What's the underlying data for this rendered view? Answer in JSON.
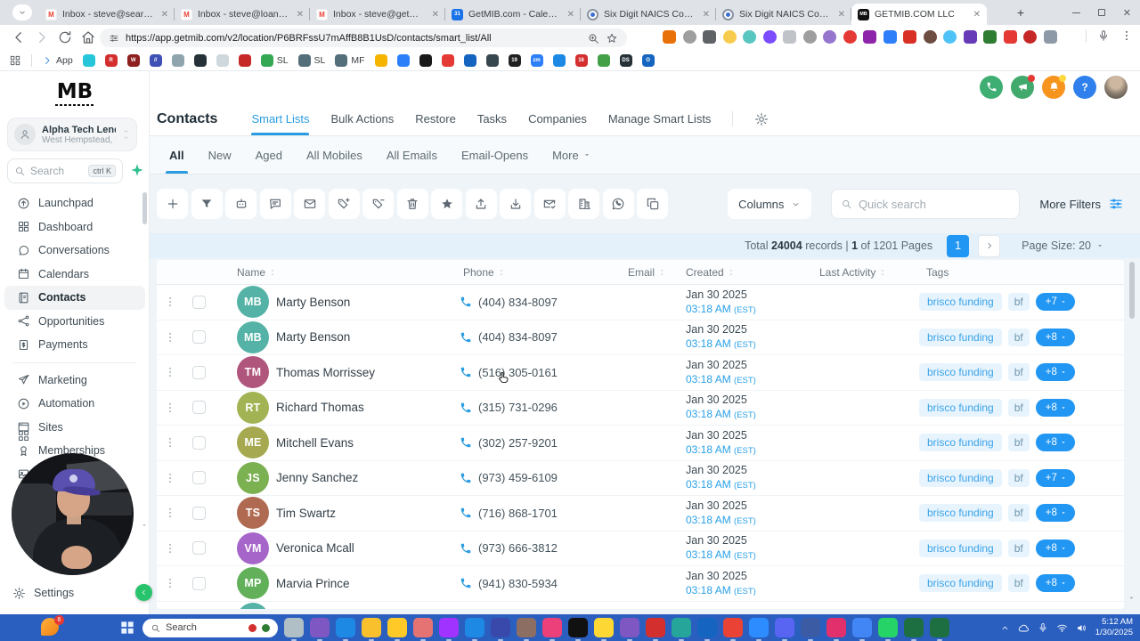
{
  "browser": {
    "tabs": [
      {
        "title": "Inbox - steve@searchlightlend",
        "favicon": "gmail",
        "active": false
      },
      {
        "title": "Inbox - steve@loandaddy.ai - C",
        "favicon": "gmail",
        "active": false
      },
      {
        "title": "Inbox - steve@getmib.com - G",
        "favicon": "gmail",
        "active": false
      },
      {
        "title": "GetMIB.com - Calendar - Week",
        "favicon": "calendar",
        "active": false
      },
      {
        "title": "Six Digit NAICS Codes & Titles",
        "favicon": "naics",
        "active": false
      },
      {
        "title": "Six Digit NAICS Codes & Titles",
        "favicon": "naics",
        "active": false
      },
      {
        "title": "GETMIB.COM LLC",
        "favicon": "mb",
        "active": true
      }
    ],
    "url": "https://app.getmib.com/v2/location/P6BRFssU7mAffB8B1UsD/contacts/smart_list/All",
    "extensions": [
      "#e8710a",
      "#9e9e9e",
      "#5f6368",
      "#f7cb4d",
      "#58c7c0",
      "#7c4dff",
      "#c0c4c9",
      "#9e9e9e",
      "#9575cd",
      "#e53935",
      "#8e24aa",
      "#2d7ff9",
      "#d93025",
      "#6d4c41",
      "#4fc3f7",
      "#673ab7",
      "#2e7d32",
      "#e53935",
      "#c62828",
      "#8d99a6"
    ]
  },
  "bookmarks": {
    "app_label": "App",
    "items": [
      {
        "c": "#26c6da"
      },
      {
        "c": "#d32f2f",
        "t": "R"
      },
      {
        "c": "#8d1f1f",
        "t": "W"
      },
      {
        "c": "#3f51b5",
        "t": "//"
      },
      {
        "c": "#90a4ae"
      },
      {
        "c": "#263238"
      },
      {
        "c": "#cfd8dc"
      },
      {
        "c": "#c62828"
      },
      {
        "c": "#34a853",
        "label": "SL"
      },
      {
        "c": "#546e7a",
        "label": "SL"
      },
      {
        "c": "#546e7a",
        "label": "MF"
      },
      {
        "c": "#f4b400"
      },
      {
        "c": "#2d7ff9"
      },
      {
        "c": "#1a1a1a"
      },
      {
        "c": "#e53935"
      },
      {
        "c": "#1565c0"
      },
      {
        "c": "#37474f"
      },
      {
        "c": "#212121",
        "t": "19"
      },
      {
        "c": "#2d7ff9",
        "t": "zm"
      },
      {
        "c": "#1e88e5"
      },
      {
        "c": "#d32f2f",
        "t": "16"
      },
      {
        "c": "#43a047"
      },
      {
        "c": "#263238",
        "t": "DS"
      },
      {
        "c": "#1565c0",
        "t": "O"
      }
    ]
  },
  "sidebar": {
    "logo": "MB",
    "account": {
      "name": "Alpha Tech Lending",
      "location": "West Hempstead, NY"
    },
    "search": {
      "placeholder": "Search",
      "shortcut": "ctrl K"
    },
    "items": [
      {
        "icon": "launchpad",
        "label": "Launchpad"
      },
      {
        "icon": "dashboard",
        "label": "Dashboard"
      },
      {
        "icon": "conversations",
        "label": "Conversations"
      },
      {
        "icon": "calendars",
        "label": "Calendars"
      },
      {
        "icon": "contactsbook",
        "label": "Contacts",
        "active": true
      },
      {
        "icon": "opportunities",
        "label": "Opportunities"
      },
      {
        "icon": "payments",
        "label": "Payments"
      },
      {
        "divider": true
      },
      {
        "icon": "marketing",
        "label": "Marketing"
      },
      {
        "icon": "automation",
        "label": "Automation"
      },
      {
        "icon": "sites",
        "label": "Sites"
      },
      {
        "icon": "memberships",
        "label": "Memberships"
      },
      {
        "icon": "media",
        "label": ""
      }
    ],
    "settings_label": "Settings"
  },
  "header_icons": [
    "phone",
    "megaphone",
    "notifications",
    "help",
    "profile"
  ],
  "page": {
    "title": "Contacts",
    "tabs": [
      {
        "label": "Smart Lists",
        "active": true
      },
      {
        "label": "Bulk Actions",
        "active": false
      },
      {
        "label": "Restore",
        "active": false
      },
      {
        "label": "Tasks",
        "active": false
      },
      {
        "label": "Companies",
        "active": false
      },
      {
        "label": "Manage Smart Lists",
        "active": false
      }
    ],
    "filter_tabs": [
      {
        "label": "All",
        "active": true
      },
      {
        "label": "New",
        "active": false
      },
      {
        "label": "Aged",
        "active": false
      },
      {
        "label": "All Mobiles",
        "active": false
      },
      {
        "label": "All Emails",
        "active": false
      },
      {
        "label": "Email-Opens",
        "active": false
      },
      {
        "label": "More",
        "active": false,
        "caret": true
      }
    ]
  },
  "toolbar": {
    "buttons": [
      "plus",
      "funnel",
      "bot",
      "sms",
      "mail",
      "tagplus",
      "tagminus",
      "trash",
      "starfill",
      "upload",
      "download",
      "mailcheck",
      "building",
      "whatsapp",
      "copy"
    ],
    "columns_label": "Columns",
    "search_placeholder": "Quick search",
    "more_filters_label": "More Filters"
  },
  "pagination": {
    "total_label": "Total",
    "total": "24004",
    "mid": "records |",
    "page": "1",
    "pages": "of 1201 Pages",
    "page_btn": "1",
    "size_label": "Page Size: 20"
  },
  "table": {
    "columns": [
      {
        "label": "Name",
        "sort": true
      },
      {
        "label": "Phone",
        "sort": true
      },
      {
        "label": "Email",
        "sort": true
      },
      {
        "label": "Created",
        "sort": true
      },
      {
        "label": "Last Activity",
        "sort": true
      },
      {
        "label": "Tags",
        "sort": false
      }
    ],
    "rows": [
      {
        "initials": "MB",
        "color": "#54b3a6",
        "name": "Marty Benson",
        "phone": "(404) 834-8097",
        "date": "Jan 30 2025",
        "time": "03:18 AM",
        "tz": "(EST)",
        "tag1": "brisco funding",
        "tag2": "bf",
        "more": "+7"
      },
      {
        "initials": "MB",
        "color": "#54b3a6",
        "name": "Marty Benson",
        "phone": "(404) 834-8097",
        "date": "Jan 30 2025",
        "time": "03:18 AM",
        "tz": "(EST)",
        "tag1": "brisco funding",
        "tag2": "bf",
        "more": "+8"
      },
      {
        "initials": "TM",
        "color": "#b0557c",
        "name": "Thomas Morrissey",
        "phone": "(516) 305-0161",
        "date": "Jan 30 2025",
        "time": "03:18 AM",
        "tz": "(EST)",
        "tag1": "brisco funding",
        "tag2": "bf",
        "more": "+8"
      },
      {
        "initials": "RT",
        "color": "#a2b353",
        "name": "Richard Thomas",
        "phone": "(315) 731-0296",
        "date": "Jan 30 2025",
        "time": "03:18 AM",
        "tz": "(EST)",
        "tag1": "brisco funding",
        "tag2": "bf",
        "more": "+8"
      },
      {
        "initials": "ME",
        "color": "#a6a94f",
        "name": "Mitchell Evans",
        "phone": "(302) 257-9201",
        "date": "Jan 30 2025",
        "time": "03:18 AM",
        "tz": "(EST)",
        "tag1": "brisco funding",
        "tag2": "bf",
        "more": "+8"
      },
      {
        "initials": "JS",
        "color": "#7cb152",
        "name": "Jenny Sanchez",
        "phone": "(973) 459-6109",
        "date": "Jan 30 2025",
        "time": "03:18 AM",
        "tz": "(EST)",
        "tag1": "brisco funding",
        "tag2": "bf",
        "more": "+7"
      },
      {
        "initials": "TS",
        "color": "#b06a52",
        "name": "Tim Swartz",
        "phone": "(716) 868-1701",
        "date": "Jan 30 2025",
        "time": "03:18 AM",
        "tz": "(EST)",
        "tag1": "brisco funding",
        "tag2": "bf",
        "more": "+8"
      },
      {
        "initials": "VM",
        "color": "#a565c9",
        "name": "Veronica Mcall",
        "phone": "(973) 666-3812",
        "date": "Jan 30 2025",
        "time": "03:18 AM",
        "tz": "(EST)",
        "tag1": "brisco funding",
        "tag2": "bf",
        "more": "+8"
      },
      {
        "initials": "MP",
        "color": "#62b15a",
        "name": "Marvia Prince",
        "phone": "(941) 830-5934",
        "date": "Jan 30 2025",
        "time": "03:18 AM",
        "tz": "(EST)",
        "tag1": "brisco funding",
        "tag2": "bf",
        "more": "+8"
      }
    ],
    "partial_row": {
      "initials": "",
      "color": "#54b3a6",
      "name": "",
      "phone": "",
      "date": "",
      "time": "",
      "tz": "",
      "tag1": "",
      "tag2": "",
      "more": ""
    }
  },
  "taskbar": {
    "badge": "6",
    "search_placeholder": "Search",
    "apps": [
      {
        "c": "#b0bec5",
        "n": "task-view"
      },
      {
        "c": "#7e57c2",
        "n": "copilot"
      },
      {
        "c": "#1e88e5",
        "n": "edge"
      },
      {
        "c": "#f8c02c",
        "n": "file-explorer"
      },
      {
        "c": "#ffca28",
        "n": "sticky-notes"
      },
      {
        "c": "#e57373",
        "n": "snipping-tool"
      },
      {
        "c": "#a033ff",
        "n": "messenger"
      },
      {
        "c": "#1e88e5",
        "n": "outlook"
      },
      {
        "c": "#3949ab",
        "n": "teams"
      },
      {
        "c": "#8d6e63",
        "n": "briefcase"
      },
      {
        "c": "#ec407a",
        "n": "photos"
      },
      {
        "c": "#111111",
        "n": "tiktok"
      },
      {
        "c": "#fdd835",
        "n": "snapchat"
      },
      {
        "c": "#7e57c2",
        "n": "app-flower"
      },
      {
        "c": "#d32f2f",
        "n": "opera"
      },
      {
        "c": "#26a69a",
        "n": "app-globe"
      },
      {
        "c": "#1565c0",
        "n": "docs"
      },
      {
        "c": "#ea4335",
        "n": "chrome"
      },
      {
        "c": "#2d8cff",
        "n": "zoom"
      },
      {
        "c": "#5865f2",
        "n": "discord"
      },
      {
        "c": "#3b5ba5",
        "n": "bell-app"
      },
      {
        "c": "#e1306c",
        "n": "instagram"
      },
      {
        "c": "#4285f4",
        "n": "chrome-profile"
      },
      {
        "c": "#25d366",
        "n": "whatsapp"
      },
      {
        "c": "#1d6f42",
        "n": "excel-doc"
      },
      {
        "c": "#1d6f42",
        "n": "excel"
      }
    ],
    "time": "5:12 AM",
    "date": "1/30/2025"
  }
}
